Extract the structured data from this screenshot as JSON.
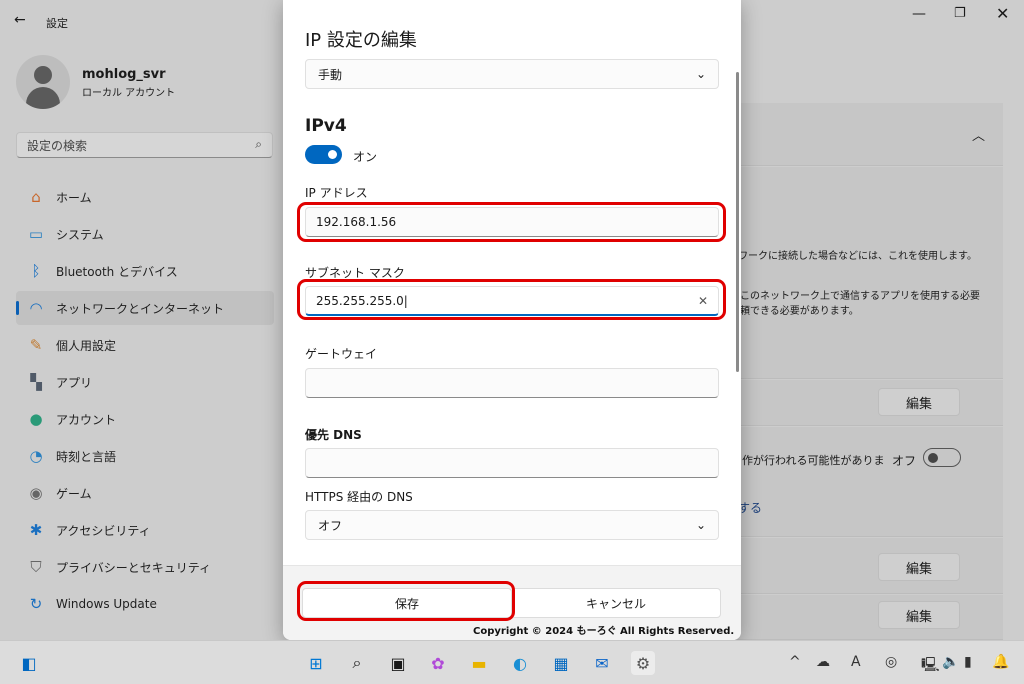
{
  "window": {
    "title": "設定",
    "back_icon": "arrow-left-icon",
    "min_icon": "minimize-icon",
    "max_icon": "restore-icon",
    "close_icon": "close-icon"
  },
  "user": {
    "name": "mohlog_svr",
    "type": "ローカル アカウント"
  },
  "search": {
    "placeholder": "設定の検索"
  },
  "sidebar": {
    "items": [
      {
        "label": "ホーム",
        "icon": "home-icon"
      },
      {
        "label": "システム",
        "icon": "system-icon"
      },
      {
        "label": "Bluetooth とデバイス",
        "icon": "bluetooth-icon"
      },
      {
        "label": "ネットワークとインターネット",
        "icon": "wifi-icon",
        "active": true
      },
      {
        "label": "個人用設定",
        "icon": "brush-icon"
      },
      {
        "label": "アプリ",
        "icon": "apps-icon"
      },
      {
        "label": "アカウント",
        "icon": "account-icon"
      },
      {
        "label": "時刻と言語",
        "icon": "globe-clock-icon"
      },
      {
        "label": "ゲーム",
        "icon": "gamepad-icon"
      },
      {
        "label": "アクセシビリティ",
        "icon": "accessibility-icon"
      },
      {
        "label": "プライバシーとセキュリティ",
        "icon": "shield-icon"
      },
      {
        "label": "Windows Update",
        "icon": "update-icon"
      }
    ]
  },
  "background": {
    "text1": "ワークに接続した場合などには、これを使用します。",
    "text2a": "このネットワーク上で通信するアプリを使用する必要",
    "text2b": "頼できる必要があります。",
    "edit_label": "編集",
    "text3": "作が行われる可能性がありま",
    "toggle_label": "オフ",
    "toggle_on": false,
    "link": "する"
  },
  "dialog": {
    "title": "IP 設定の編集",
    "mode": "手動",
    "ipv4_heading": "IPv4",
    "ipv4_toggle_label": "オン",
    "ipv4_on": true,
    "ip_label": "IP アドレス",
    "ip_value": "192.168.1.56",
    "subnet_label": "サブネット マスク",
    "subnet_value": "255.255.255.0",
    "gateway_label": "ゲートウェイ",
    "gateway_value": "",
    "dns_label": "優先 DNS",
    "dns_value": "",
    "https_dns_label": "HTTPS 経由の DNS",
    "https_dns_value": "オフ",
    "save": "保存",
    "cancel": "キャンセル"
  },
  "watermark": "Copyright © 2024 もーろぐ All Rights Reserved.",
  "colors": {
    "accent": "#0067c0",
    "highlight": "#e00000"
  }
}
